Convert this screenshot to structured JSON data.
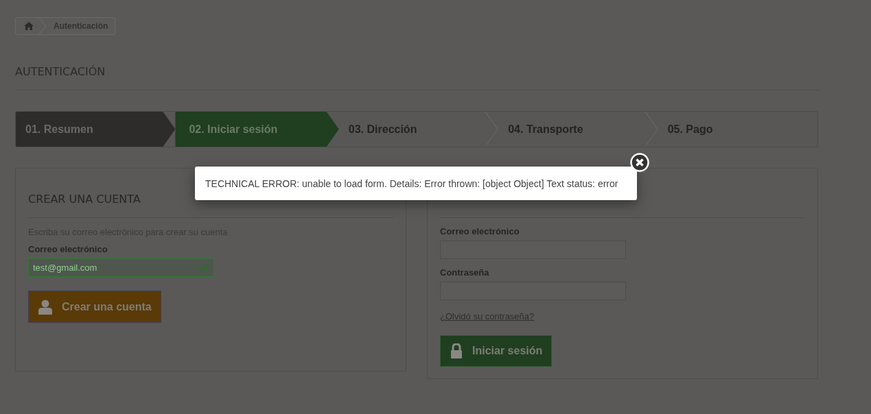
{
  "breadcrumb": {
    "current": "Autenticación"
  },
  "page_title": "AUTENTICACIÓN",
  "steps": [
    {
      "label": "01. Resumen",
      "selected": false
    },
    {
      "label": "02. Iniciar sesión",
      "selected": true
    },
    {
      "label": "03. Dirección",
      "selected": false
    },
    {
      "label": "04. Transporte",
      "selected": false
    },
    {
      "label": "05. Pago",
      "selected": false
    }
  ],
  "create_account": {
    "title": "CREAR UNA CUENTA",
    "hint": "Escriba su correo electrónico para crear su cuenta",
    "email_label": "Correo electrónico",
    "email_value": "test@gmail.com",
    "email_valid": true,
    "button": "Crear una cuenta"
  },
  "login": {
    "email_label": "Correo electrónico",
    "password_label": "Contraseña",
    "forgot_link": "¿Olvidó su contraseña?",
    "button": "Iniciar sesión"
  },
  "error_popup": {
    "message": "TECHNICAL ERROR: unable to load form. Details: Error thrown: [object Object] Text status: error"
  }
}
